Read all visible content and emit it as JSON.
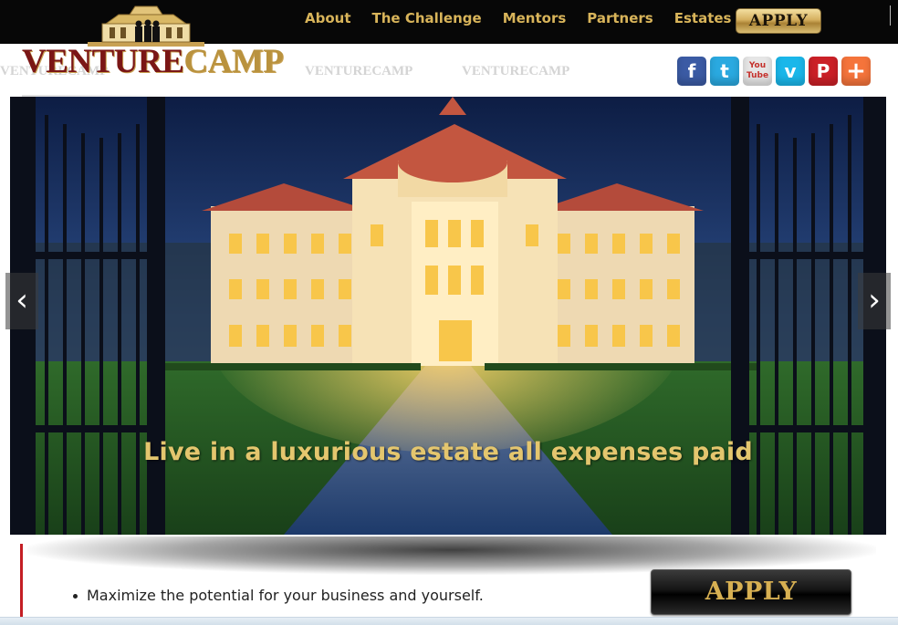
{
  "nav": {
    "items": [
      "About",
      "The Challenge",
      "Mentors",
      "Partners",
      "Estates"
    ],
    "apply_label": "APPLY"
  },
  "logo": {
    "word1": "VENTURE",
    "word2": "CAMP",
    "brand_colors": {
      "venture": "#7a1616",
      "camp": "#b9923e"
    }
  },
  "watermark_text": "VENTURECAMP",
  "social": [
    {
      "icon": "facebook-icon",
      "glyph": "f",
      "color": "#3b5ba4"
    },
    {
      "icon": "twitter-icon",
      "glyph": "t",
      "color": "#2aa9e0"
    },
    {
      "icon": "youtube-icon",
      "glyph": "You Tube",
      "color": "#e6e6e6"
    },
    {
      "icon": "vimeo-icon",
      "glyph": "v",
      "color": "#1ab7ea"
    },
    {
      "icon": "pinterest-icon",
      "glyph": "P",
      "color": "#cb2027"
    },
    {
      "icon": "addthis-icon",
      "glyph": "+",
      "color": "#f5743b"
    }
  ],
  "hero": {
    "caption": "Live in a luxurious estate all expenses paid",
    "prev_glyph": "‹",
    "next_glyph": "›"
  },
  "bottom": {
    "bullet": "Maximize the potential for your business and yourself.",
    "apply_label": "APPLY"
  },
  "colors": {
    "accent_gold": "#d8b45a",
    "accent_red": "#c41e24"
  }
}
